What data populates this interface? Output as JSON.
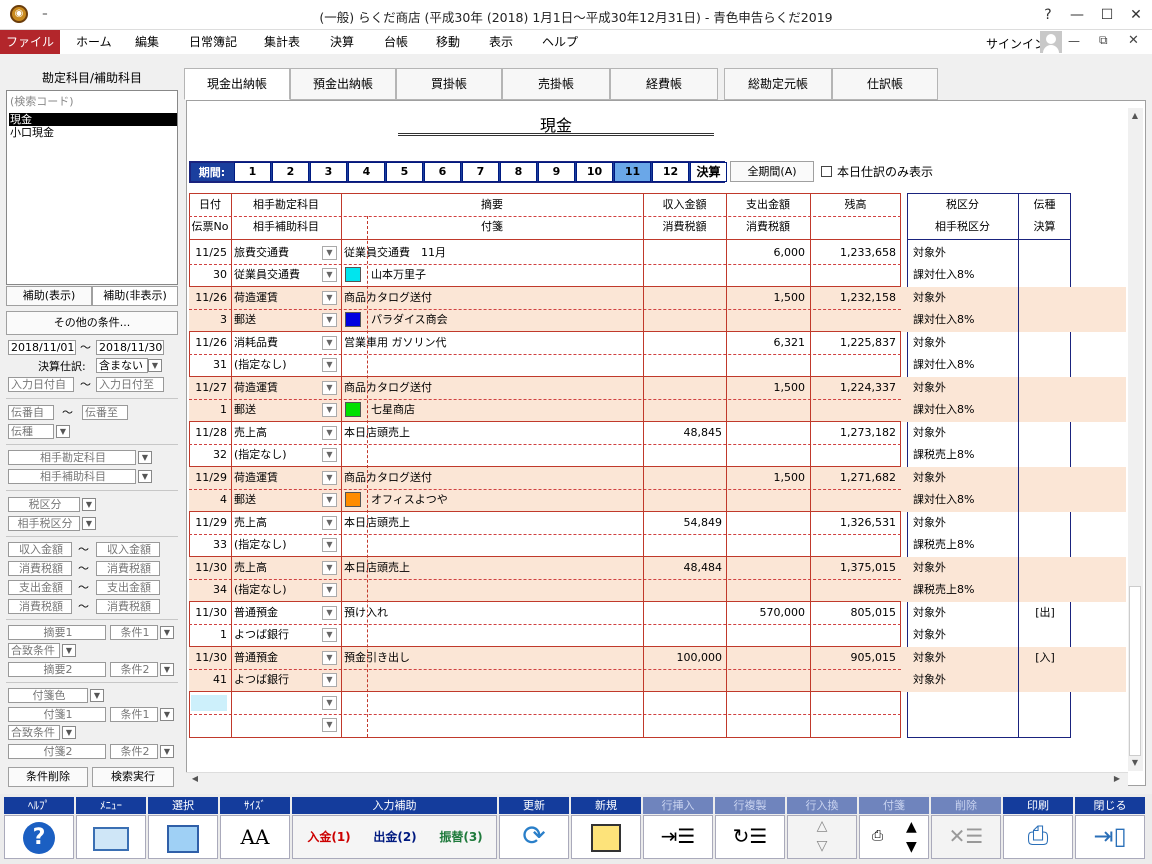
{
  "window": {
    "title": "(一般) らくだ商店 (平成30年 (2018) 1月1日～平成30年12月31日) - 青色申告らくだ2019",
    "help": "?",
    "quick_access": "₌"
  },
  "menu": [
    "ファイル",
    "ホーム",
    "編集",
    "日常簿記",
    "集計表",
    "決算",
    "台帳",
    "移動",
    "表示",
    "ヘルプ"
  ],
  "signin": "サインイン",
  "left": {
    "title": "勘定科目/補助科目",
    "search_placeholder": "(検索コード)",
    "items": [
      "現金",
      "小口現金"
    ],
    "tab_show": "補助(表示)",
    "tab_hide": "補助(非表示)",
    "other_conditions": "その他の条件...",
    "date_from": "2018/11/01",
    "date_to": "2018/11/30",
    "tilde": "〜",
    "kessan_label": "決算仕訳:",
    "kessan_value": "含まない",
    "entry_from": "入力日付自",
    "entry_to": "入力日付至",
    "slip_from": "伝番自",
    "slip_to": "伝番至",
    "slip_type": "伝種",
    "counter_account": "相手勘定科目",
    "counter_sub": "相手補助科目",
    "tax_cat": "税区分",
    "counter_tax": "相手税区分",
    "income_from": "収入金額",
    "income_to": "収入金額",
    "tax1_from": "消費税額",
    "tax1_to": "消費税額",
    "expense_from": "支出金額",
    "expense_to": "支出金額",
    "tax2_from": "消費税額",
    "tax2_to": "消費税額",
    "memo1": "摘要1",
    "cond1": "条件1",
    "match1": "合致条件",
    "memo2": "摘要2",
    "cond2": "条件2",
    "tagcolor": "付箋色",
    "tag1": "付箋1",
    "tcond1": "条件1",
    "match2": "合致条件",
    "tag2": "付箋2",
    "tcond2": "条件2",
    "clear": "条件削除",
    "search": "検索実行"
  },
  "tabs": [
    "現金出納帳",
    "預金出納帳",
    "買掛帳",
    "売掛帳",
    "経費帳",
    "総勘定元帳",
    "仕訳帳"
  ],
  "ledger_title": "現金",
  "period": {
    "label": "期間:",
    "months": [
      "1",
      "2",
      "3",
      "4",
      "5",
      "6",
      "7",
      "8",
      "9",
      "10",
      "11",
      "12"
    ],
    "kessan": "決算",
    "selected": "11",
    "all": "全期間(A)",
    "today_only": "本日仕訳のみ表示"
  },
  "headers": {
    "date": "日付",
    "account": "相手勘定科目",
    "memo": "摘要",
    "income": "収入金額",
    "expense": "支出金額",
    "balance": "残高",
    "tax": "税区分",
    "slip": "伝種",
    "slipno": "伝票No",
    "subaccount": "相手補助科目",
    "tag": "付箋",
    "income_tax": "消費税額",
    "expense_tax": "消費税額",
    "counter_tax": "相手税区分",
    "settle": "決算"
  },
  "rows": [
    {
      "date": "11/25",
      "account": "旅費交通費",
      "memo": "従業員交通費　11月",
      "income": "",
      "expense": "6,000",
      "balance": "1,233,658",
      "tax": "対象外",
      "slip": "",
      "no": "30",
      "sub": "従業員交通費",
      "tag": "山本万里子",
      "tag_color": "#00e5ee",
      "ctax": "課対仕入8%",
      "shade": false
    },
    {
      "date": "11/26",
      "account": "荷造運賃",
      "memo": "商品カタログ送付",
      "income": "",
      "expense": "1,500",
      "balance": "1,232,158",
      "tax": "対象外",
      "slip": "",
      "no": "3",
      "sub": "郵送",
      "tag": "パラダイス商会",
      "tag_color": "#0000e0",
      "ctax": "課対仕入8%",
      "shade": true
    },
    {
      "date": "11/26",
      "account": "消耗品費",
      "memo": "営業車用 ガソリン代",
      "income": "",
      "expense": "6,321",
      "balance": "1,225,837",
      "tax": "対象外",
      "slip": "",
      "no": "31",
      "sub": "(指定なし)",
      "tag": "",
      "tag_color": "",
      "ctax": "課対仕入8%",
      "shade": false
    },
    {
      "date": "11/27",
      "account": "荷造運賃",
      "memo": "商品カタログ送付",
      "income": "",
      "expense": "1,500",
      "balance": "1,224,337",
      "tax": "対象外",
      "slip": "",
      "no": "1",
      "sub": "郵送",
      "tag": "七星商店",
      "tag_color": "#00e000",
      "ctax": "課対仕入8%",
      "shade": true
    },
    {
      "date": "11/28",
      "account": "売上高",
      "memo": "本日店頭売上",
      "income": "48,845",
      "expense": "",
      "balance": "1,273,182",
      "tax": "対象外",
      "slip": "",
      "no": "32",
      "sub": "(指定なし)",
      "tag": "",
      "tag_color": "",
      "ctax": "課税売上8%",
      "shade": false
    },
    {
      "date": "11/29",
      "account": "荷造運賃",
      "memo": "商品カタログ送付",
      "income": "",
      "expense": "1,500",
      "balance": "1,271,682",
      "tax": "対象外",
      "slip": "",
      "no": "4",
      "sub": "郵送",
      "tag": "オフィスよつや",
      "tag_color": "#ff8c00",
      "ctax": "課対仕入8%",
      "shade": true
    },
    {
      "date": "11/29",
      "account": "売上高",
      "memo": "本日店頭売上",
      "income": "54,849",
      "expense": "",
      "balance": "1,326,531",
      "tax": "対象外",
      "slip": "",
      "no": "33",
      "sub": "(指定なし)",
      "tag": "",
      "tag_color": "",
      "ctax": "課税売上8%",
      "shade": false
    },
    {
      "date": "11/30",
      "account": "売上高",
      "memo": "本日店頭売上",
      "income": "48,484",
      "expense": "",
      "balance": "1,375,015",
      "tax": "対象外",
      "slip": "",
      "no": "34",
      "sub": "(指定なし)",
      "tag": "",
      "tag_color": "",
      "ctax": "課税売上8%",
      "shade": true
    },
    {
      "date": "11/30",
      "account": "普通預金",
      "memo": "預け入れ",
      "income": "",
      "expense": "570,000",
      "balance": "805,015",
      "tax": "対象外",
      "slip": "[出]",
      "no": "1",
      "sub": "よつば銀行",
      "tag": "",
      "tag_color": "",
      "ctax": "対象外",
      "shade": false
    },
    {
      "date": "11/30",
      "account": "普通預金",
      "memo": "預金引き出し",
      "income": "100,000",
      "expense": "",
      "balance": "905,015",
      "tax": "対象外",
      "slip": "[入]",
      "no": "41",
      "sub": "よつば銀行",
      "tag": "",
      "tag_color": "",
      "ctax": "対象外",
      "shade": true
    }
  ],
  "toolbar": {
    "help": "ﾍﾙﾌﾟ",
    "menu": "ﾒﾆｭｰ",
    "select": "選択",
    "size": "ｻｲｽﾞ",
    "input_assist": "入力補助",
    "update": "更新",
    "new": "新規",
    "row_insert": "行挿入",
    "row_copy": "行複製",
    "row_swap": "行入換",
    "tag": "付箋",
    "delete": "削除",
    "print": "印刷",
    "close": "閉じる",
    "in": "入金(1)",
    "out": "出金(2)",
    "transfer": "振替(3)",
    "size_icon": "AA"
  }
}
